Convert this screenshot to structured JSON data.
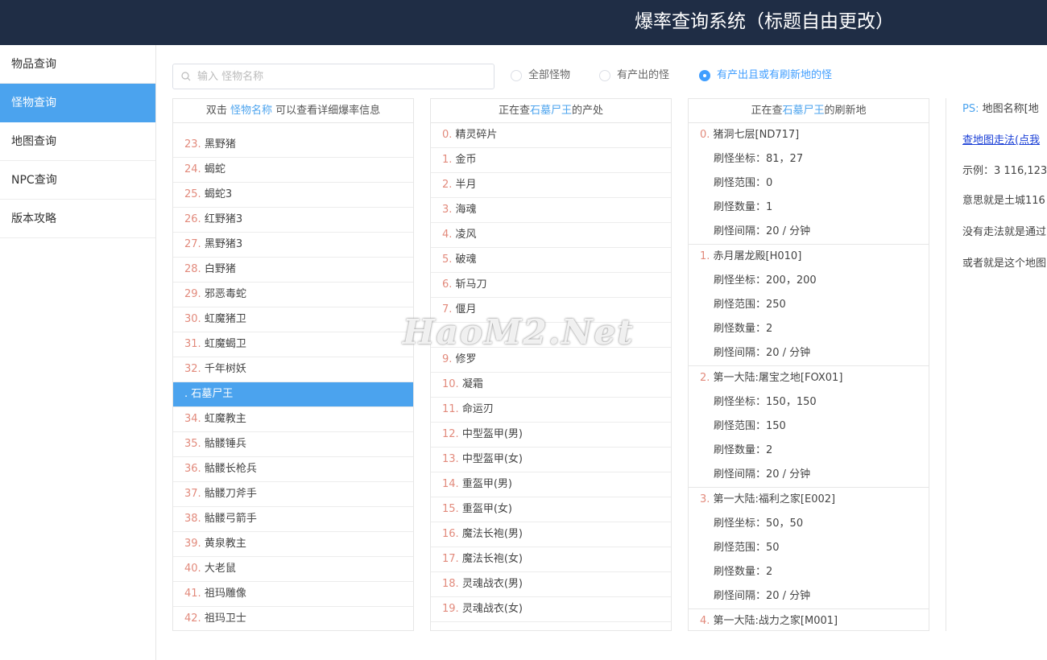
{
  "header": {
    "title": "爆率查询系统（标题自由更改）"
  },
  "sidebar": {
    "items": [
      {
        "label": "物品查询"
      },
      {
        "label": "怪物查询"
      },
      {
        "label": "地图查询"
      },
      {
        "label": "NPC查询"
      },
      {
        "label": "版本攻略"
      }
    ]
  },
  "search": {
    "placeholder": "输入 怪物名称",
    "value": ""
  },
  "filters": [
    {
      "label": "全部怪物",
      "checked": false
    },
    {
      "label": "有产出的怪",
      "checked": false
    },
    {
      "label": "有产出且或有刷新地的怪",
      "checked": true
    }
  ],
  "monster_panel": {
    "header_prefix": "双击",
    "header_link": "怪物名称",
    "header_suffix": "可以查看详细爆率信息",
    "rows": [
      {
        "num": "23.",
        "name": "黑野猪"
      },
      {
        "num": "24.",
        "name": "蝎蛇"
      },
      {
        "num": "25.",
        "name": "蝎蛇3"
      },
      {
        "num": "26.",
        "name": "红野猪3"
      },
      {
        "num": "27.",
        "name": "黑野猪3"
      },
      {
        "num": "28.",
        "name": "白野猪"
      },
      {
        "num": "29.",
        "name": "邪恶毒蛇"
      },
      {
        "num": "30.",
        "name": "虹魔猪卫"
      },
      {
        "num": "31.",
        "name": "虹魔蝎卫"
      },
      {
        "num": "32.",
        "name": "千年树妖"
      },
      {
        "num": "",
        "name": ". 石墓尸王"
      },
      {
        "num": "34.",
        "name": "虹魔教主"
      },
      {
        "num": "35.",
        "name": "骷髅锤兵"
      },
      {
        "num": "36.",
        "name": "骷髅长枪兵"
      },
      {
        "num": "37.",
        "name": "骷髅刀斧手"
      },
      {
        "num": "38.",
        "name": "骷髅弓箭手"
      },
      {
        "num": "39.",
        "name": "黄泉教主"
      },
      {
        "num": "40.",
        "name": "大老鼠"
      },
      {
        "num": "41.",
        "name": "祖玛雕像"
      },
      {
        "num": "42.",
        "name": "祖玛卫士"
      }
    ]
  },
  "drops_panel": {
    "header_prefix": "正在查",
    "header_monster": "石墓尸王",
    "header_suffix": "的产处",
    "rows": [
      {
        "num": "0.",
        "name": "精灵碎片"
      },
      {
        "num": "1.",
        "name": "金币"
      },
      {
        "num": "2.",
        "name": "半月"
      },
      {
        "num": "3.",
        "name": "海魂"
      },
      {
        "num": "4.",
        "name": "凌风"
      },
      {
        "num": "5.",
        "name": "破魂"
      },
      {
        "num": "6.",
        "name": "斩马刀"
      },
      {
        "num": "7.",
        "name": "偃月"
      },
      {
        "num": "",
        "name": ""
      },
      {
        "num": "9.",
        "name": "修罗"
      },
      {
        "num": "10.",
        "name": "凝霜"
      },
      {
        "num": "11.",
        "name": "命运刃"
      },
      {
        "num": "12.",
        "name": "中型盔甲(男)"
      },
      {
        "num": "13.",
        "name": "中型盔甲(女)"
      },
      {
        "num": "14.",
        "name": "重盔甲(男)"
      },
      {
        "num": "15.",
        "name": "重盔甲(女)"
      },
      {
        "num": "16.",
        "name": "魔法长袍(男)"
      },
      {
        "num": "17.",
        "name": "魔法长袍(女)"
      },
      {
        "num": "18.",
        "name": "灵魂战衣(男)"
      },
      {
        "num": "19.",
        "name": "灵魂战衣(女)"
      }
    ]
  },
  "spawn_panel": {
    "header_prefix": "正在查",
    "header_monster": "石墓尸王",
    "header_suffix": "的刷新地",
    "entries": [
      {
        "num": "0.",
        "map": "猪洞七层[ND717]",
        "coords": "刷怪坐标：81，27",
        "range": "刷怪范围：0",
        "count": "刷怪数量：1",
        "interval": "刷怪间隔：20 / 分钟"
      },
      {
        "num": "1.",
        "map": "赤月屠龙殿[H010]",
        "coords": "刷怪坐标：200，200",
        "range": "刷怪范围：250",
        "count": "刷怪数量：2",
        "interval": "刷怪间隔：20 / 分钟"
      },
      {
        "num": "2.",
        "map": "第一大陆:屠宝之地[FOX01]",
        "coords": "刷怪坐标：150，150",
        "range": "刷怪范围：150",
        "count": "刷怪数量：2",
        "interval": "刷怪间隔：20 / 分钟"
      },
      {
        "num": "3.",
        "map": "第一大陆:福利之家[E002]",
        "coords": "刷怪坐标：50，50",
        "range": "刷怪范围：50",
        "count": "刷怪数量：2",
        "interval": "刷怪间隔：20 / 分钟"
      },
      {
        "num": "4.",
        "map": "第一大陆:战力之家[M001]",
        "coords": "",
        "range": "",
        "count": "",
        "interval": ""
      }
    ]
  },
  "info_panel": {
    "ps_label": "PS:",
    "ps_text": "地图名称[地",
    "link": "查地图走法(点我",
    "example": "示例：3 116,123",
    "meaning": "意思就是土城116",
    "no_route": "没有走法就是通过",
    "or_text": "或者就是这个地图"
  },
  "watermark": "HaoM2.Net"
}
